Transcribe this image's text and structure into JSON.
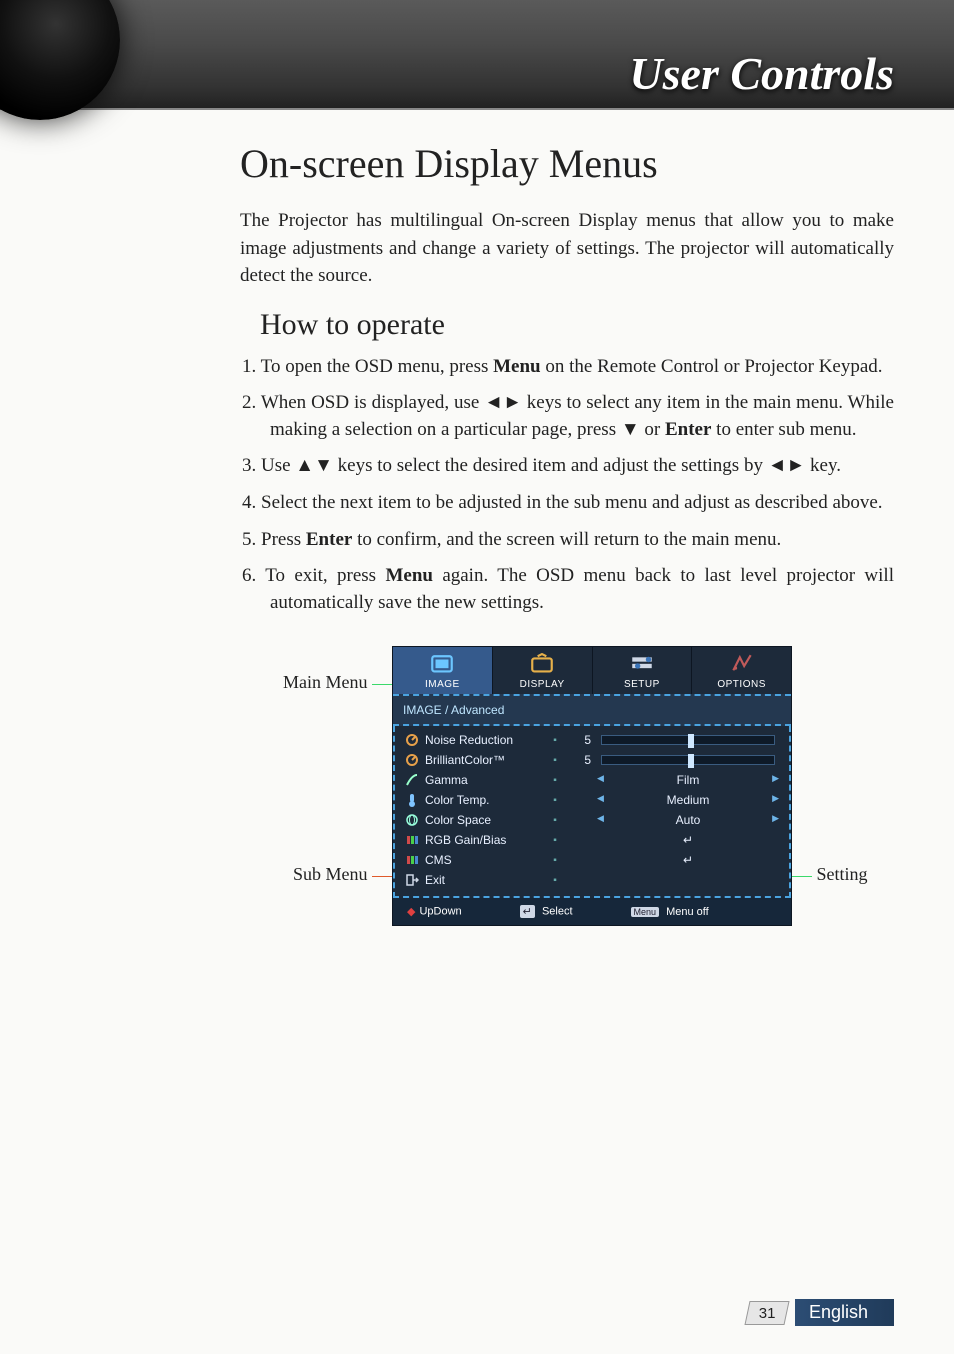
{
  "header": {
    "title": "User Controls"
  },
  "page": {
    "heading": "On-screen Display Menus",
    "intro": "The Projector has multilingual On-screen Display menus that allow you to make image adjustments and change a variety of settings. The projector will automatically detect the source.",
    "subheading": "How to operate",
    "steps": [
      "To open the OSD menu, press <b>Menu</b> on the Remote Control or Projector Keypad.",
      "When OSD is displayed, use ◄► keys to select any item in the main menu. While making a selection on a particular page, press ▼ or <b>Enter</b> to enter sub menu.",
      "Use ▲▼ keys to select the desired item and adjust the settings by ◄► key.",
      "Select the next item to be adjusted in the sub menu and adjust as described above.",
      "Press <b>Enter</b> to confirm, and the screen will return to the main menu.",
      "To exit, press <b>Menu</b> again. The OSD menu back to last level projector will automatically save the new settings."
    ]
  },
  "callouts": {
    "main_menu": "Main Menu",
    "sub_menu": "Sub Menu",
    "setting": "Setting"
  },
  "osd": {
    "tabs": [
      {
        "id": "image",
        "label": "IMAGE",
        "active": true
      },
      {
        "id": "display",
        "label": "DISPLAY",
        "active": false
      },
      {
        "id": "setup",
        "label": "SETUP",
        "active": false
      },
      {
        "id": "options",
        "label": "OPTIONS",
        "active": false
      }
    ],
    "breadcrumb": "IMAGE / Advanced",
    "rows": [
      {
        "icon": "dial",
        "label": "Noise Reduction",
        "kind": "slider",
        "value": "5",
        "pos": 50
      },
      {
        "icon": "dial",
        "label": "BrilliantColor™",
        "kind": "slider",
        "value": "5",
        "pos": 50
      },
      {
        "icon": "curve",
        "label": "Gamma",
        "kind": "select",
        "value": "Film"
      },
      {
        "icon": "therm",
        "label": "Color Temp.",
        "kind": "select",
        "value": "Medium"
      },
      {
        "icon": "globe",
        "label": "Color Space",
        "kind": "select",
        "value": "Auto"
      },
      {
        "icon": "bars",
        "label": "RGB Gain/Bias",
        "kind": "enter",
        "value": "↵"
      },
      {
        "icon": "bars",
        "label": "CMS",
        "kind": "enter",
        "value": "↵"
      },
      {
        "icon": "exit",
        "label": "Exit",
        "kind": "none",
        "value": ""
      }
    ],
    "hints": {
      "updown": "UpDown",
      "select": "Select",
      "menu_off": "Menu off",
      "menu_key": "Menu"
    }
  },
  "footer": {
    "page_number": "31",
    "language": "English"
  }
}
